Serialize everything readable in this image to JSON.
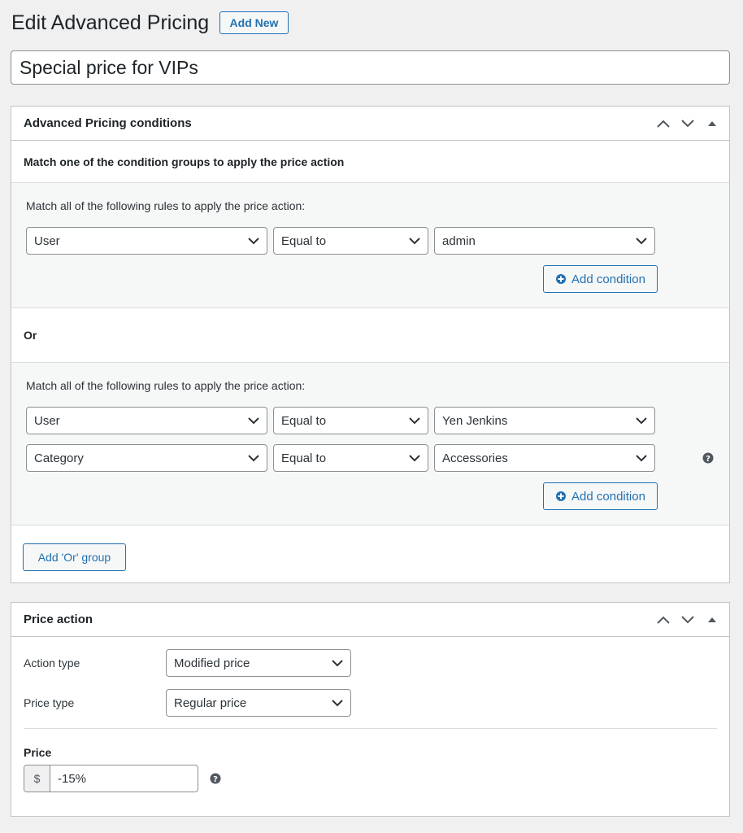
{
  "header": {
    "title": "Edit Advanced Pricing",
    "add_new_label": "Add New",
    "post_title_value": "Special price for VIPs"
  },
  "conditions_box": {
    "title": "Advanced Pricing conditions",
    "intro": "Match one of the condition groups to apply the price action",
    "groups": [
      {
        "label": "Match all of the following rules to apply the price action:",
        "rules": [
          {
            "field": "User",
            "operator": "Equal to",
            "value": "admin"
          }
        ],
        "add_condition_label": "Add condition"
      },
      {
        "label": "Match all of the following rules to apply the price action:",
        "rules": [
          {
            "field": "User",
            "operator": "Equal to",
            "value": "Yen Jenkins"
          },
          {
            "field": "Category",
            "operator": "Equal to",
            "value": "Accessories"
          }
        ],
        "add_condition_label": "Add condition"
      }
    ],
    "or_label": "Or",
    "add_or_group_label": "Add 'Or' group"
  },
  "price_action_box": {
    "title": "Price action",
    "action_type_label": "Action type",
    "action_type_value": "Modified price",
    "price_type_label": "Price type",
    "price_type_value": "Regular price",
    "price_label": "Price",
    "currency_symbol": "$",
    "price_value": "-15%"
  },
  "colors": {
    "accent": "#2271b1",
    "background": "#f0f0f1",
    "group_background": "#f6f7f7",
    "text": "#1d2327"
  }
}
